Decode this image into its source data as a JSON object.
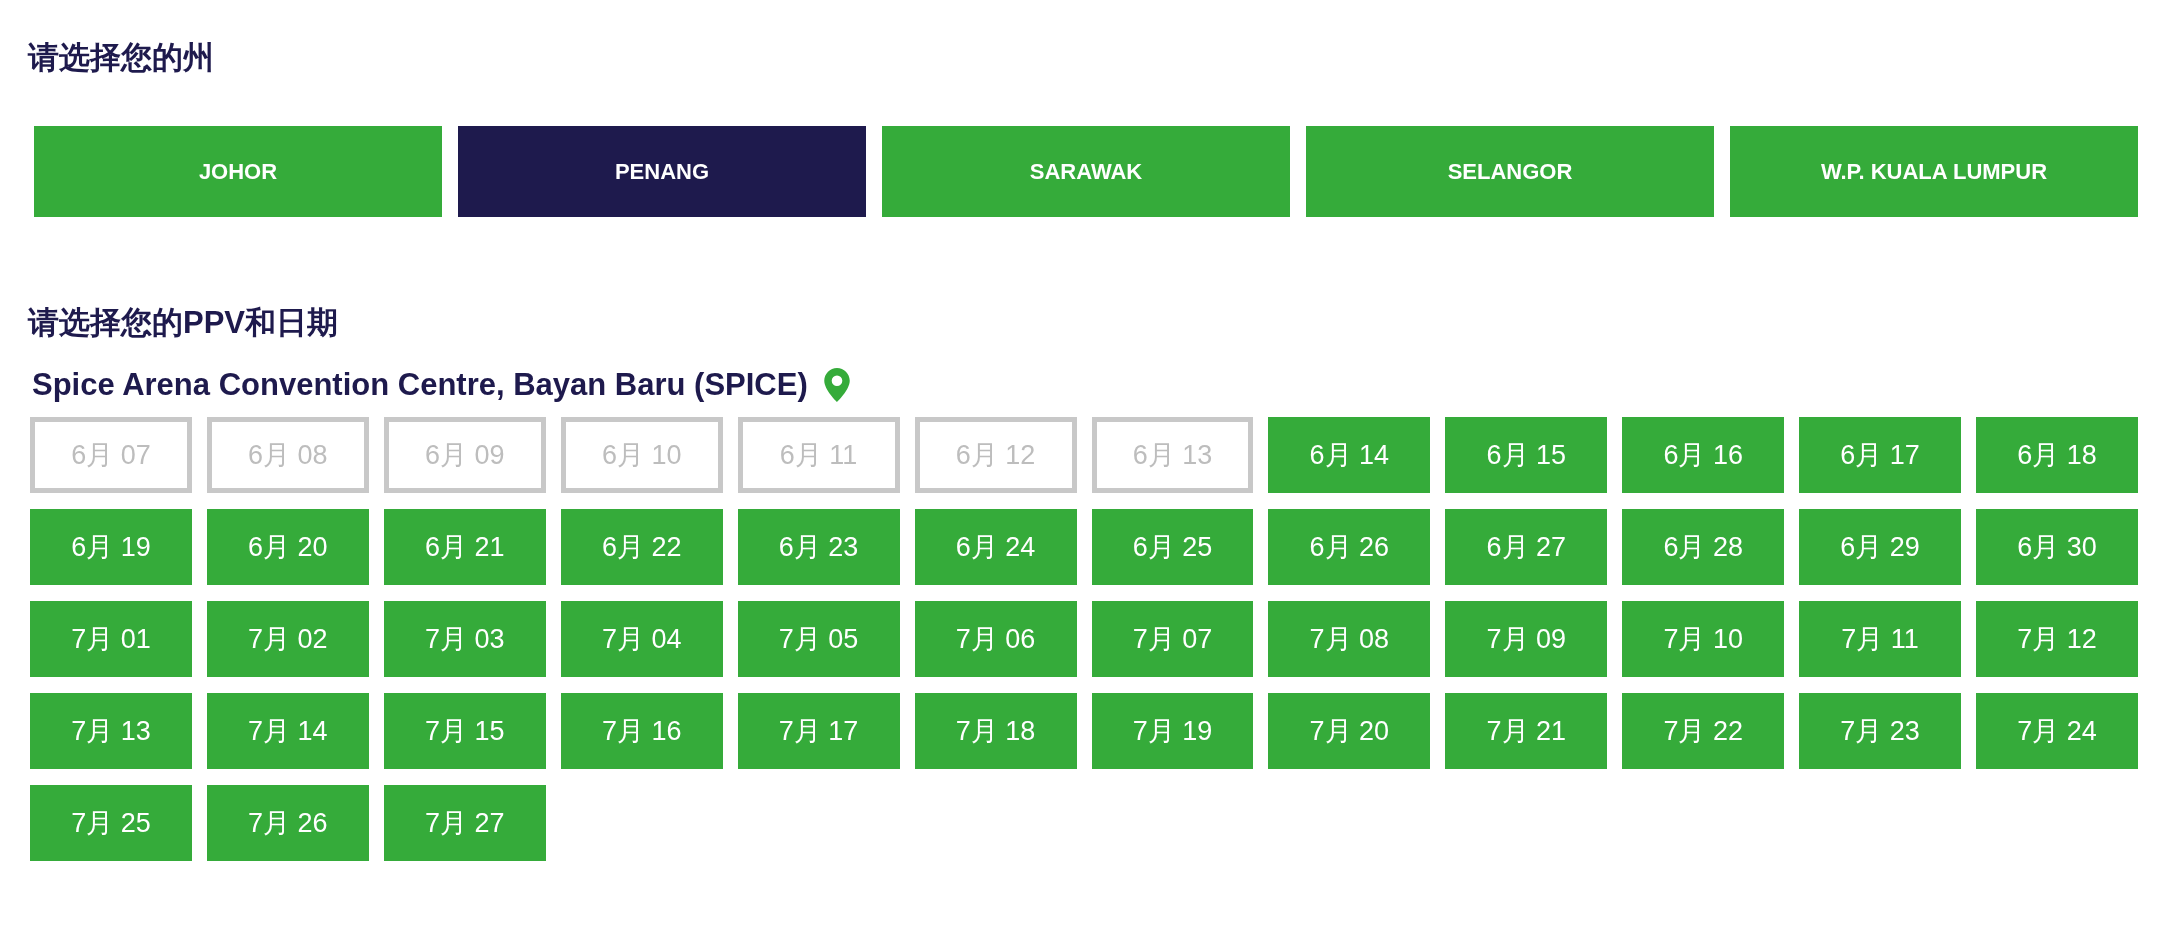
{
  "state_heading": "请选择您的州",
  "states": [
    {
      "label": "JOHOR",
      "selected": false
    },
    {
      "label": "PENANG",
      "selected": true
    },
    {
      "label": "SARAWAK",
      "selected": false
    },
    {
      "label": "SELANGOR",
      "selected": false
    },
    {
      "label": "W.P. KUALA LUMPUR",
      "selected": false
    }
  ],
  "ppv_heading": "请选择您的PPV和日期",
  "venue": {
    "name": "Spice Arena Convention Centre, Bayan Baru (SPICE)"
  },
  "dates": [
    {
      "label": "6月 07",
      "disabled": true
    },
    {
      "label": "6月 08",
      "disabled": true
    },
    {
      "label": "6月 09",
      "disabled": true
    },
    {
      "label": "6月 10",
      "disabled": true
    },
    {
      "label": "6月 11",
      "disabled": true
    },
    {
      "label": "6月 12",
      "disabled": true
    },
    {
      "label": "6月 13",
      "disabled": true
    },
    {
      "label": "6月 14",
      "disabled": false
    },
    {
      "label": "6月 15",
      "disabled": false
    },
    {
      "label": "6月 16",
      "disabled": false
    },
    {
      "label": "6月 17",
      "disabled": false
    },
    {
      "label": "6月 18",
      "disabled": false
    },
    {
      "label": "6月 19",
      "disabled": false
    },
    {
      "label": "6月 20",
      "disabled": false
    },
    {
      "label": "6月 21",
      "disabled": false
    },
    {
      "label": "6月 22",
      "disabled": false
    },
    {
      "label": "6月 23",
      "disabled": false
    },
    {
      "label": "6月 24",
      "disabled": false
    },
    {
      "label": "6月 25",
      "disabled": false
    },
    {
      "label": "6月 26",
      "disabled": false
    },
    {
      "label": "6月 27",
      "disabled": false
    },
    {
      "label": "6月 28",
      "disabled": false
    },
    {
      "label": "6月 29",
      "disabled": false
    },
    {
      "label": "6月 30",
      "disabled": false
    },
    {
      "label": "7月 01",
      "disabled": false
    },
    {
      "label": "7月 02",
      "disabled": false
    },
    {
      "label": "7月 03",
      "disabled": false
    },
    {
      "label": "7月 04",
      "disabled": false
    },
    {
      "label": "7月 05",
      "disabled": false
    },
    {
      "label": "7月 06",
      "disabled": false
    },
    {
      "label": "7月 07",
      "disabled": false
    },
    {
      "label": "7月 08",
      "disabled": false
    },
    {
      "label": "7月 09",
      "disabled": false
    },
    {
      "label": "7月 10",
      "disabled": false
    },
    {
      "label": "7月 11",
      "disabled": false
    },
    {
      "label": "7月 12",
      "disabled": false
    },
    {
      "label": "7月 13",
      "disabled": false
    },
    {
      "label": "7月 14",
      "disabled": false
    },
    {
      "label": "7月 15",
      "disabled": false
    },
    {
      "label": "7月 16",
      "disabled": false
    },
    {
      "label": "7月 17",
      "disabled": false
    },
    {
      "label": "7月 18",
      "disabled": false
    },
    {
      "label": "7月 19",
      "disabled": false
    },
    {
      "label": "7月 20",
      "disabled": false
    },
    {
      "label": "7月 21",
      "disabled": false
    },
    {
      "label": "7月 22",
      "disabled": false
    },
    {
      "label": "7月 23",
      "disabled": false
    },
    {
      "label": "7月 24",
      "disabled": false
    },
    {
      "label": "7月 25",
      "disabled": false
    },
    {
      "label": "7月 26",
      "disabled": false
    },
    {
      "label": "7月 27",
      "disabled": false
    }
  ]
}
